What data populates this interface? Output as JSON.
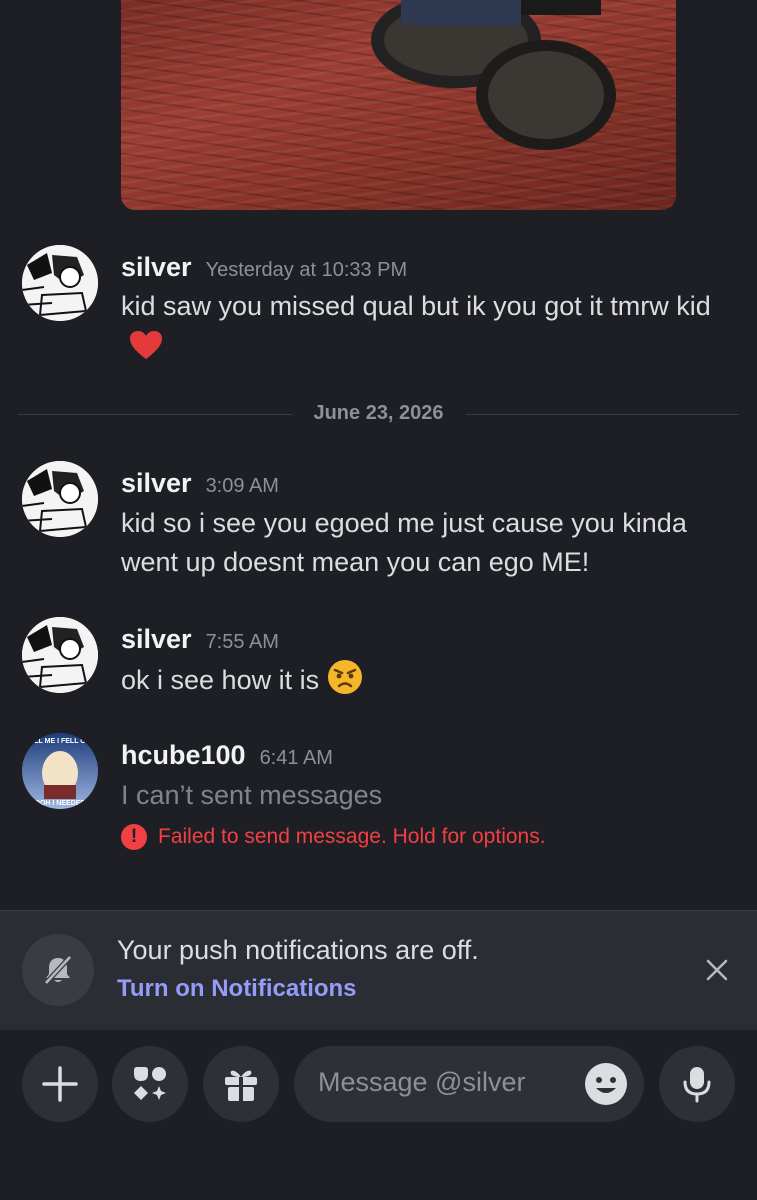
{
  "messages": [
    {
      "author": "silver",
      "time": "Yesterday at 10:33 PM",
      "text": "kid saw you missed qual but ik you got it tmrw kid",
      "emoji": "red-heart"
    },
    {
      "author": "silver",
      "time": "3:09 AM",
      "text": "kid so i see you egoed me just cause  you kinda went up doesnt mean you can ego ME!"
    },
    {
      "author": "silver",
      "time": "7:55 AM",
      "text": "ok i see how it is",
      "emoji": "angry-face"
    },
    {
      "author": "hcube100",
      "time": "6:41 AM",
      "text": "I can’t sent messages",
      "error": "Failed to send message. Hold for options."
    }
  ],
  "date_divider": "June 23, 2026",
  "hcube_avatar_text": {
    "top": "LL ME I FELL O",
    "bottom": "OOH I NEEDED"
  },
  "notification_banner": {
    "title": "Your push notifications are off.",
    "link": "Turn on Notifications"
  },
  "composer": {
    "placeholder": "Message @silver"
  },
  "icons": [
    "plus-icon",
    "apps-icon",
    "gift-icon",
    "emoji-icon",
    "microphone-icon",
    "bell-off-icon",
    "close-icon",
    "error-icon"
  ],
  "colors": {
    "background": "#1e1f24",
    "error": "#f23f43",
    "link": "#949cf7"
  }
}
